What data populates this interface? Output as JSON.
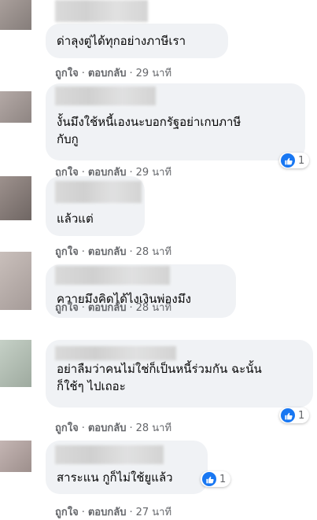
{
  "actions": {
    "like": "ถูกใจ",
    "reply": "ตอบกลับ",
    "dot": "·"
  },
  "comments": [
    {
      "lines": [
        "ด่าลุงตู่ได้ทุกอย่างภาษีเรา"
      ],
      "time": "29 นาที",
      "reactions": ""
    },
    {
      "lines": [
        "งั้นมึงใช้หนี้เองนะบอกรัฐอย่าเกบภาษี",
        "กับกู"
      ],
      "time": "29 นาที",
      "reactions": "1"
    },
    {
      "lines": [
        "แล้วแต่"
      ],
      "time": "28 นาที",
      "reactions": ""
    },
    {
      "lines": [
        "ควายมึงคิดได้ไงเงินพ่องมึง"
      ],
      "time": "28 นาที",
      "reactions": ""
    },
    {
      "lines": [
        "อย่าลืมว่าคนไม่ใช่ก็เป็นหนี้ร่วมกัน ฉะนั้น",
        "ก็ใช้ๆ ไปเถอะ"
      ],
      "time": "28 นาที",
      "reactions": "1"
    },
    {
      "lines": [
        "สาระแน กูก็ไม่ใช้ยูแล้ว"
      ],
      "time": "27 นาที",
      "reactions": "1"
    }
  ],
  "colors": {
    "bubble": "#f0f2f5",
    "like": "#1877f2",
    "meta": "#65676b"
  },
  "icons": {
    "reaction": "like-thumb-icon"
  }
}
